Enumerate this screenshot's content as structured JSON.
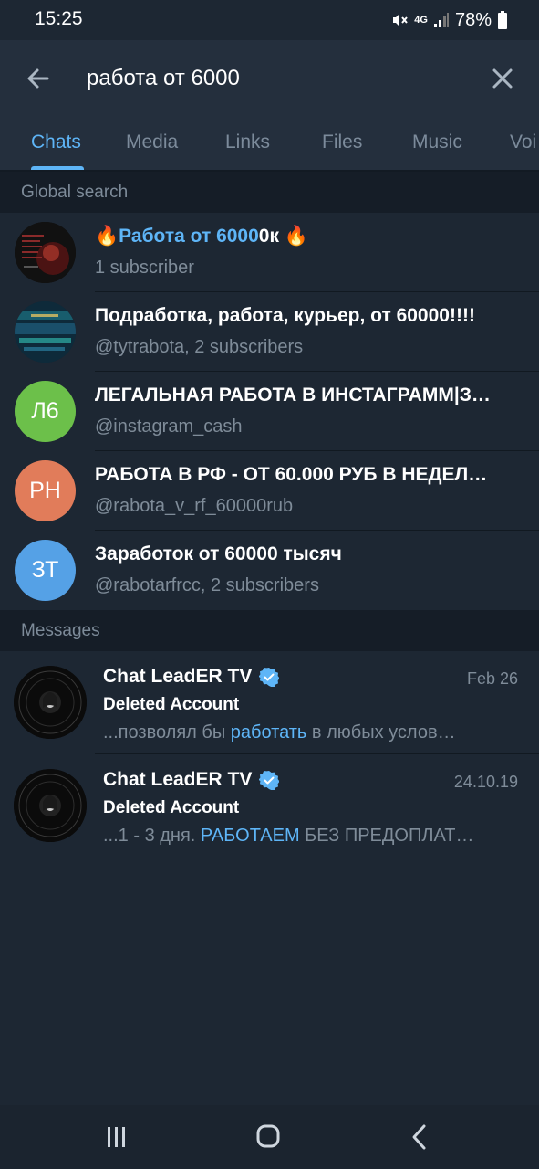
{
  "status": {
    "time": "15:25",
    "network": "4G",
    "battery": "78%"
  },
  "search": {
    "query": "работа от 6000"
  },
  "tabs": [
    {
      "label": "Chats",
      "active": true
    },
    {
      "label": "Media"
    },
    {
      "label": "Links"
    },
    {
      "label": "Files"
    },
    {
      "label": "Music"
    },
    {
      "label": "Voi"
    }
  ],
  "sections": {
    "global": "Global search",
    "messages": "Messages"
  },
  "global_results": [
    {
      "title_prefix": "🔥",
      "title_highlight": "Работа от 6000",
      "title_rest": "0к 🔥",
      "subtitle": "1 subscriber",
      "avatar": "image"
    },
    {
      "title": "Подработка, работа, курьер, от 60000!!!!",
      "subtitle": "@tytrabota, 2 subscribers",
      "avatar": "image"
    },
    {
      "title": "ЛЕГАЛЬНАЯ РАБОТА В ИНСТАГРАММ|З…",
      "subtitle": "@instagram_cash",
      "initials": "Л6",
      "color": "#6cc04a"
    },
    {
      "title": "РАБОТА В РФ - ОТ 60.000 РУБ В НЕДЕЛ…",
      "subtitle": "@rabota_v_rf_60000rub",
      "initials": "РН",
      "color": "#e17c5a"
    },
    {
      "title": "Заработок от 60000 тысяч",
      "subtitle": "@rabotarfrcc, 2 subscribers",
      "initials": "ЗТ",
      "color": "#55a1e6"
    }
  ],
  "messages": [
    {
      "title": "Chat LeadER TV",
      "verified": true,
      "date": "Feb 26",
      "sender": "Deleted Account",
      "preview_before": "...позволял бы ",
      "preview_highlight": "работать",
      "preview_after": " в любых услов…"
    },
    {
      "title": "Chat LeadER TV",
      "verified": true,
      "date": "24.10.19",
      "sender": "Deleted Account",
      "preview_before": "...1 - 3 дня. ",
      "preview_highlight": "РАБОТАЕМ",
      "preview_after": " БЕЗ ПРЕДОПЛАТ…"
    }
  ],
  "colors": {
    "accent": "#5eb5f7",
    "header": "#242f3d",
    "background": "#1d2733",
    "verified": "#5eb5f7"
  },
  "icons": {
    "back": "arrow-left-icon",
    "clear": "close-icon",
    "verified": "verified-badge-icon",
    "nav_recent": "recent-apps-icon",
    "nav_home": "home-icon",
    "nav_back": "back-chevron-icon"
  }
}
